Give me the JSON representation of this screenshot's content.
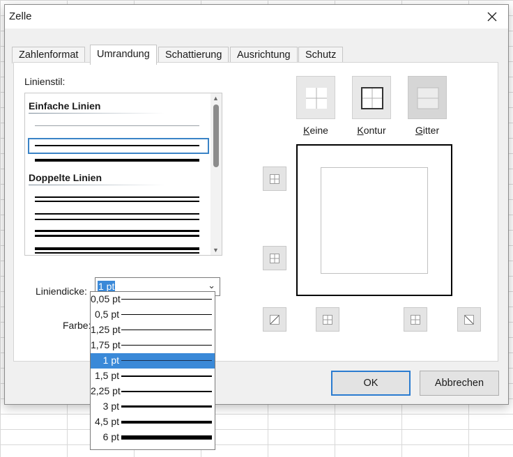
{
  "window": {
    "title": "Zelle",
    "close_icon": "close-icon"
  },
  "tabs": [
    {
      "label": "Zahlenformat"
    },
    {
      "label": "Umrandung",
      "active": true
    },
    {
      "label": "Schattierung"
    },
    {
      "label": "Ausrichtung"
    },
    {
      "label": "Schutz"
    }
  ],
  "line_style": {
    "label": "Linienstil:",
    "sections": [
      {
        "heading": "Einfache Linien"
      },
      {
        "heading": "Doppelte Linien"
      }
    ]
  },
  "line_width": {
    "label": "Liniendicke:",
    "value": "1 pt",
    "options": [
      "0,05 pt",
      "0,5 pt",
      "1,25 pt",
      "1,75 pt",
      "1 pt",
      "1,5 pt",
      "2,25 pt",
      "3 pt",
      "4,5 pt",
      "6 pt"
    ],
    "selected_index": 4
  },
  "color": {
    "label": "Farbe:"
  },
  "presets": [
    {
      "label": "Keine",
      "icon": "border-none-icon"
    },
    {
      "label": "Kontur",
      "icon": "border-outline-icon"
    },
    {
      "label": "Gitter",
      "icon": "border-grid-icon"
    }
  ],
  "buttons": {
    "ok": "OK",
    "cancel": "Abbrechen"
  },
  "colors": {
    "accent": "#3a89d8",
    "focus_border": "#2a7bd0",
    "dialog_bg": "#f0f0f0"
  }
}
